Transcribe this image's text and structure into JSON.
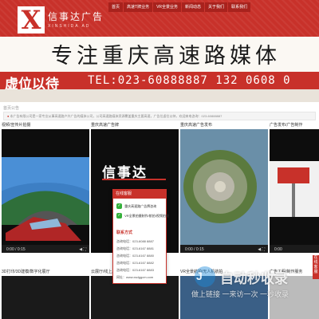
{
  "header": {
    "brand_letter": "X",
    "brand_name": "信事达广告",
    "brand_sub": "XINSHIDA AD",
    "nav": [
      "首页",
      "高速T牌业务",
      "VR全景业务",
      "新闻动态",
      "关于我们",
      "联系我们"
    ]
  },
  "hero": {
    "title": "专注重庆高速路媒体",
    "slogan": "虚位以待",
    "tel": "TEL:023-60888887  132 0608 0"
  },
  "breadcrumb": "首页公告",
  "notice": "本广告有限公司是一家专业从事高速路户外广告的媒体公司，公司高速路媒体资源覆盖重庆主要高速，广告位虚位以待，欢迎来电咨询：023-60888887",
  "cards": [
    {
      "title": "视频/宣传片拍摄",
      "time": "0:00 / 0:15",
      "photo": "road"
    },
    {
      "title": "重庆高速广告牌",
      "time": "0:00 / 0:15",
      "photo": "dark",
      "overlay": "信事达"
    },
    {
      "title": "重庆高速广告发布",
      "time": "0:00 / 0:15",
      "photo": "sphere"
    },
    {
      "title": "广告发布/广告制作",
      "time": "0:00",
      "photo": "pole"
    }
  ],
  "row2": [
    "3D打印/3D建模/数字化展厅",
    "云展厅/线上展厅",
    "VR全景航拍/无人机航拍",
    "广告工程/制作服务"
  ],
  "popup": {
    "header": "在线客服",
    "wechat": [
      "重庆高速路广告牌咨询",
      "VR全景拍摄制作/航拍/视频拍摄"
    ],
    "contact_title": "联系方式",
    "lines": [
      "咨询电话：023-6088 8887",
      "咨询电话：023-6167 8881",
      "咨询电话：023-6167 8880",
      "咨询电话：023-6167 8882",
      "咨询电话：023-6167 8883",
      "网址：www.xsdggcm.com"
    ]
  },
  "sidetab": "在线客服",
  "watermark": {
    "title": "自动秒收录",
    "sub": "做上链接 一来访一次 一秒收录"
  },
  "colors": {
    "brand": "#c8312a",
    "brand_dark": "#a8221d",
    "wechat": "#34b03a"
  },
  "icons": [
    "logo-icon",
    "wechat-icon",
    "phone-icon",
    "speaker-icon",
    "fullscreen-icon"
  ]
}
